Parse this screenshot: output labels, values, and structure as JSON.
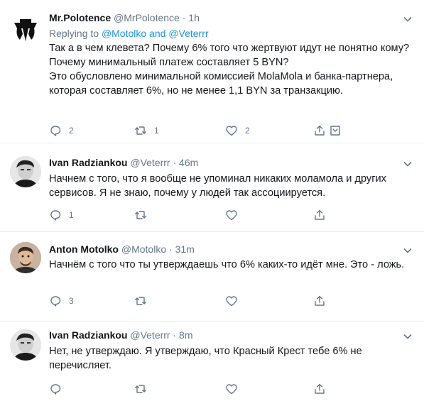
{
  "tweets": [
    {
      "name": "Mr.Polotence",
      "handle": "@MrPolotence",
      "sep": "·",
      "time": "1h",
      "replying_prefix": "Replying to",
      "replying_users": "@Motolko and @Veterrr",
      "lines": [
        "Так а в чем клевета? Почему 6% того что жертвуют идут не понятно кому?",
        "Почему минимальный платеж составляет 5 BYN?",
        "Это обусловлено минимальной комиссией MolaMola и банка-партнера, которая составляет 6%, но не менее 1,1 BYN за транзакцию."
      ],
      "reply_count": "2",
      "retweet_count": "1",
      "like_count": "2"
    },
    {
      "name": "Ivan Radziankou",
      "handle": "@Veterrr",
      "sep": "·",
      "time": "46m",
      "lines": [
        "Начнем с того, что я вообще не упоминал никаких моламола и других сервисов. Я не знаю, почему у людей так ассоциируется."
      ],
      "reply_count": "1",
      "retweet_count": "",
      "like_count": ""
    },
    {
      "name": "Anton Motolko",
      "handle": "@Motolko",
      "sep": "·",
      "time": "31m",
      "lines": [
        "Начнём с того что ты утверждаешь что 6% каких-то идёт мне. Это - ложь."
      ],
      "reply_count": "3",
      "retweet_count": "",
      "like_count": ""
    },
    {
      "name": "Ivan Radziankou",
      "handle": "@Veterrr",
      "sep": "·",
      "time": "8m",
      "lines": [
        "Нет, не утверждаю. Я утверждаю, что Красный Крест тебе 6% не перечисляет."
      ],
      "reply_count": "",
      "retweet_count": "",
      "like_count": ""
    }
  ]
}
